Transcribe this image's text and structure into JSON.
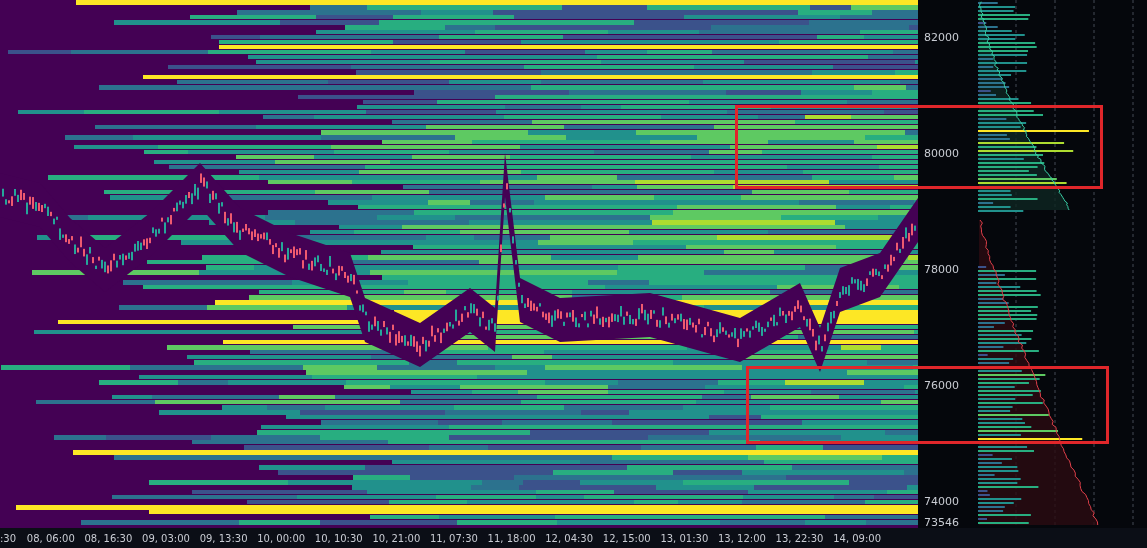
{
  "chart": {
    "price_axis": [
      "82000",
      "80000",
      "78000",
      "76000",
      "74000"
    ],
    "current_price": "73546",
    "time_axis": [
      ":30",
      "08, 06:00",
      "08, 16:30",
      "09, 03:00",
      "09, 13:30",
      "10, 00:00",
      "10, 10:30",
      "10, 21:00",
      "11, 07:30",
      "11, 18:00",
      "12, 04:30",
      "12, 15:00",
      "13, 01:30",
      "13, 12:00",
      "13, 22:30",
      "14, 09:00"
    ]
  }
}
